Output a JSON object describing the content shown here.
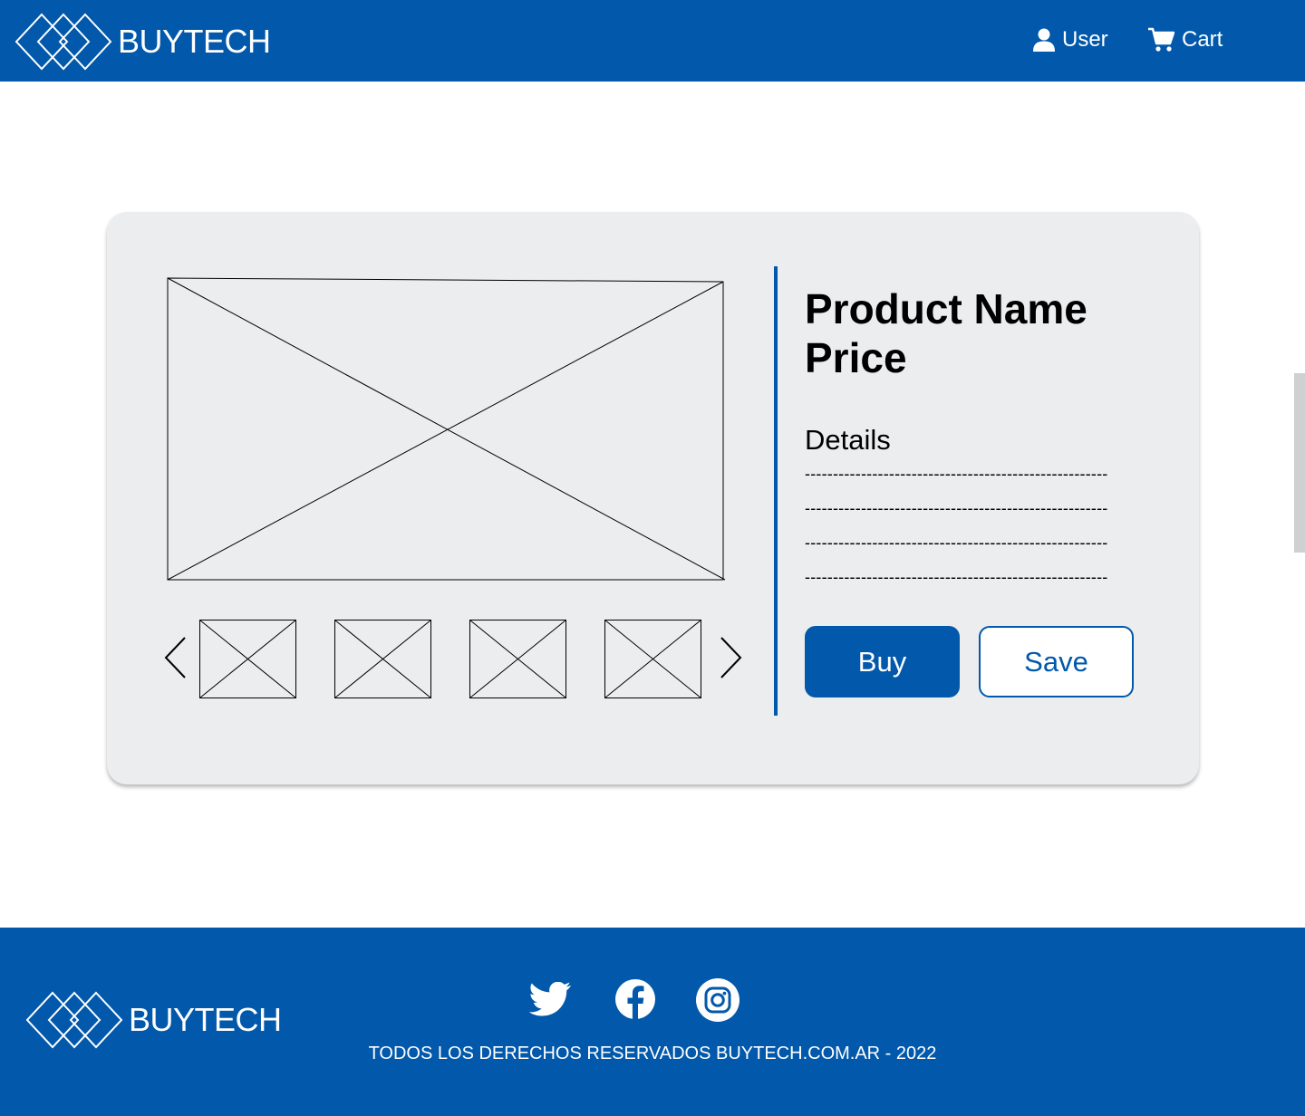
{
  "header": {
    "brand": "BUYTECH",
    "nav": [
      {
        "label": "User",
        "icon": "user-icon"
      },
      {
        "label": "Cart",
        "icon": "cart-icon"
      }
    ]
  },
  "product": {
    "name": "Product Name",
    "price": "Price",
    "details_label": "Details",
    "detail_lines": [
      "------------------------------------------------------",
      "------------------------------------------------------",
      "------------------------------------------------------",
      "------------------------------------------------------"
    ],
    "buy_label": "Buy",
    "save_label": "Save",
    "thumbnail_count": 4
  },
  "footer": {
    "brand": "BUYTECH",
    "social": [
      "twitter-icon",
      "facebook-icon",
      "instagram-icon"
    ],
    "copyright": "TODOS LOS DERECHOS RESERVADOS BUYTECH.COM.AR - 2022"
  },
  "colors": {
    "primary": "#0258aa",
    "card_bg": "#ecedef",
    "white": "#ffffff"
  }
}
